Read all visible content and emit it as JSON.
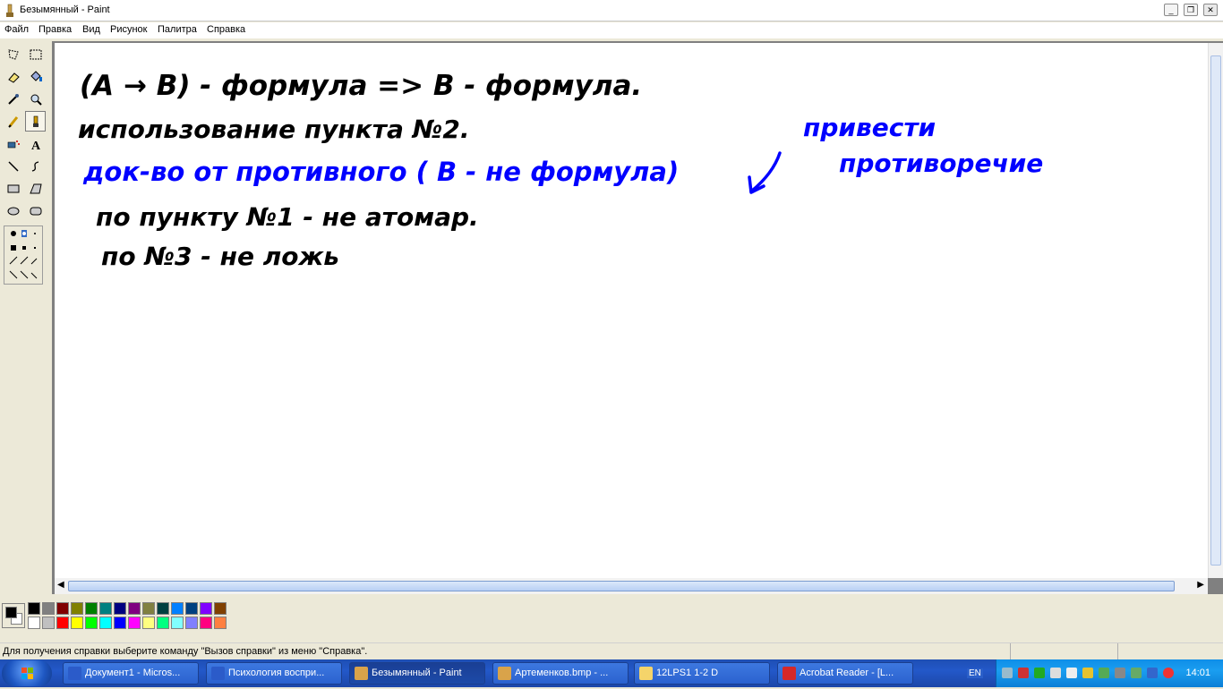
{
  "window": {
    "title": "Безымянный - Paint"
  },
  "menu": [
    "Файл",
    "Правка",
    "Вид",
    "Рисунок",
    "Палитра",
    "Справка"
  ],
  "canvas": {
    "handwriting": [
      {
        "text": "(A → B) - формула => B - формула.",
        "color": "#000000"
      },
      {
        "text": "использование пункта №2.",
        "color": "#000000"
      },
      {
        "text": "док-во от противного ( B - не формула)",
        "color": "#0000ff"
      },
      {
        "text": "привести",
        "color": "#0000ff"
      },
      {
        "text": "противоречие",
        "color": "#0000ff"
      },
      {
        "text": "по пункту №1 - не атомар.",
        "color": "#000000"
      },
      {
        "text": "по №3 - не ложь",
        "color": "#000000"
      }
    ]
  },
  "palette": {
    "primary": "#000000",
    "secondary": "#ffffff",
    "colors_top": [
      "#000000",
      "#808080",
      "#800000",
      "#808000",
      "#008000",
      "#008080",
      "#000080",
      "#800080",
      "#808040",
      "#004040",
      "#0080ff",
      "#004080",
      "#8000ff",
      "#804000"
    ],
    "colors_bottom": [
      "#ffffff",
      "#c0c0c0",
      "#ff0000",
      "#ffff00",
      "#00ff00",
      "#00ffff",
      "#0000ff",
      "#ff00ff",
      "#ffff80",
      "#00ff80",
      "#80ffff",
      "#8080ff",
      "#ff0080",
      "#ff8040"
    ]
  },
  "status": {
    "text": "Для получения справки выберите команду \"Вызов справки\" из меню \"Справка\"."
  },
  "taskbar": {
    "items": [
      {
        "label": "Документ1 - Micros...",
        "icon_color": "#2b5bc9"
      },
      {
        "label": "Психология воспри...",
        "icon_color": "#2b5bc9"
      },
      {
        "label": "Безымянный - Paint",
        "icon_color": "#d9a34a"
      },
      {
        "label": "Артеменков.bmp - ...",
        "icon_color": "#d9a34a"
      },
      {
        "label": "12LPS1 1-2 D",
        "icon_color": "#f5d46a"
      },
      {
        "label": "Acrobat Reader - [L...",
        "icon_color": "#d62828"
      }
    ],
    "language": "EN",
    "clock": "14:01"
  }
}
